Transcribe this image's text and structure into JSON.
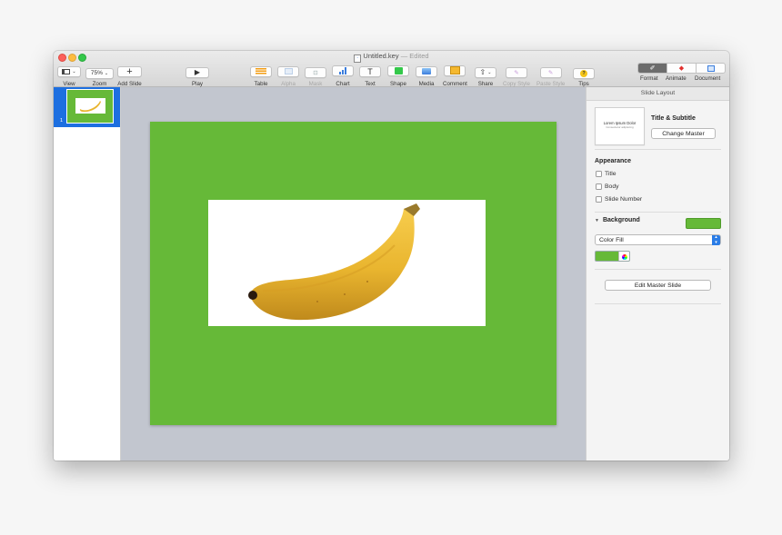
{
  "window": {
    "title": "Untitled.key",
    "status": "— Edited"
  },
  "toolbar": {
    "view_label": "View",
    "zoom_value": "75%",
    "zoom_label": "Zoom",
    "add_slide_label": "Add Slide",
    "play_label": "Play",
    "table_label": "Table",
    "alpha_label": "Alpha",
    "mask_label": "Mask",
    "chart_label": "Chart",
    "text_label": "Text",
    "shape_label": "Shape",
    "media_label": "Media",
    "comment_label": "Comment",
    "share_label": "Share",
    "copy_style_label": "Copy Style",
    "paste_style_label": "Paste Style",
    "tips_label": "Tips",
    "format_label": "Format",
    "animate_label": "Animate",
    "document_label": "Document"
  },
  "navigator": {
    "slides": [
      {
        "number": "1"
      }
    ]
  },
  "inspector": {
    "header": "Slide Layout",
    "master_thumb_title": "Lorem Ipsum Dolor",
    "master_thumb_subtitle": "Consectetur adipiscing",
    "master_name": "Title & Subtitle",
    "change_master_label": "Change Master",
    "appearance_title": "Appearance",
    "appearance_items": [
      "Title",
      "Body",
      "Slide Number"
    ],
    "background_title": "Background",
    "fill_type": "Color Fill",
    "edit_master_label": "Edit Master Slide"
  },
  "colors": {
    "slide_background": "#66b938",
    "selection": "#1d6fe0",
    "canvas": "#c2c6cf",
    "banana": "#e9b52f"
  }
}
